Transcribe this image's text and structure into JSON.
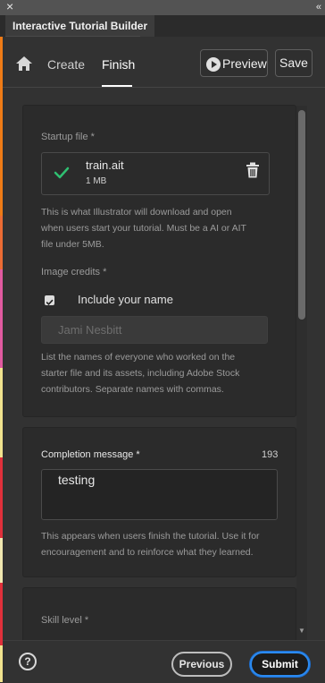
{
  "window": {
    "close_glyph": "×",
    "collapse_glyph": "«",
    "panel_title": "Interactive Tutorial Builder"
  },
  "nav": {
    "home_icon": "home-icon",
    "tabs": [
      {
        "label": "Create",
        "active": false
      },
      {
        "label": "Finish",
        "active": true
      }
    ],
    "preview_label": "Preview",
    "save_label": "Save"
  },
  "startup": {
    "label": "Startup file *",
    "file_name": "train.ait",
    "file_size": "1 MB",
    "status_icon": "check-icon",
    "delete_icon": "trash-icon",
    "help_lines": [
      "This is what Illustrator will download and open",
      "when users start your tutorial. Must be a AI or AIT",
      "file under 5MB."
    ]
  },
  "credits": {
    "label": "Image credits *",
    "checkbox_label": "Include your name",
    "checked": true,
    "name_value": "Jami Nesbitt",
    "help_lines": [
      "List the names of everyone who worked on the",
      "starter file and its assets, including Adobe Stock",
      "contributors. Separate names with commas."
    ]
  },
  "completion": {
    "label": "Completion message *",
    "char_count": "193",
    "value": "testing",
    "help_lines": [
      "This appears when users finish the tutorial. Use it for",
      "encouragement and to reinforce what they learned."
    ]
  },
  "skill": {
    "label": "Skill level *"
  },
  "footer": {
    "help_glyph": "?",
    "previous_label": "Previous",
    "submit_label": "Submit"
  },
  "colors": {
    "accent": "#2b8af0",
    "success": "#2fbf71",
    "panel_bg": "#323232",
    "card_bg": "#2b2b2b"
  }
}
